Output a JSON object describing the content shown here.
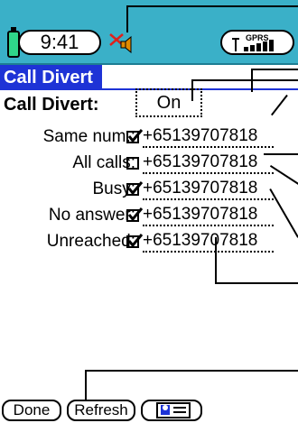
{
  "status_bar": {
    "time": "9:41",
    "signal_label": "GPRS",
    "battery_icon": "battery-icon",
    "mute_icon": "speaker-muted-icon",
    "signal_icon": "signal-strength-icon"
  },
  "title": "Call Divert",
  "divert": {
    "label": "Call Divert:",
    "value": "On"
  },
  "rows": [
    {
      "label": "Same num.:",
      "checked": true,
      "number": "+65139707818"
    },
    {
      "label": "All calls:",
      "checked": false,
      "number": "+65139707818"
    },
    {
      "label": "Busy:",
      "checked": true,
      "number": "+65139707818"
    },
    {
      "label": "No answer:",
      "checked": true,
      "number": "+65139707818"
    },
    {
      "label": "Unreached:",
      "checked": true,
      "number": "+65139707818"
    }
  ],
  "buttons": {
    "done": "Done",
    "refresh": "Refresh",
    "contacts_icon": "contacts-card-icon"
  },
  "colors": {
    "status_bar": "#3ab0c8",
    "title_bar": "#1e33d6",
    "battery_fill": "#2fd68a",
    "mute_x": "#e0201a",
    "speaker": "#e08a00"
  }
}
